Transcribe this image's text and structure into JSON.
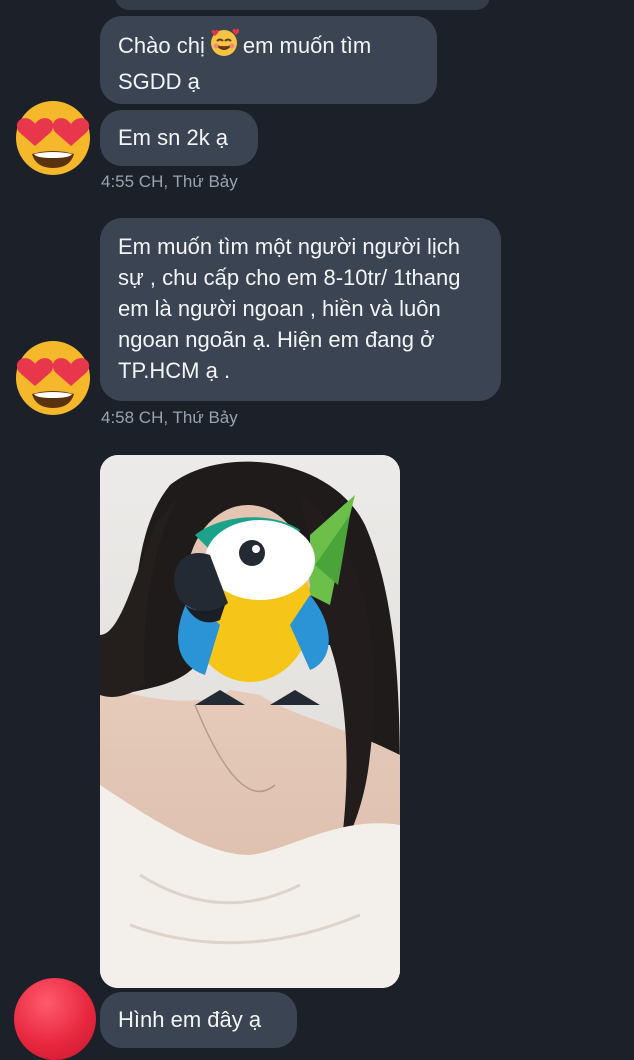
{
  "messages": [
    {
      "text_before": "Chào chị",
      "text_after": "em muốn tìm SGDD ạ",
      "inline_icon": "smiling-face-with-hearts-icon"
    },
    {
      "text": "Em sn 2k ạ"
    },
    {
      "timestamp": "4:55 CH, Thứ Bảy"
    },
    {
      "text": "Em muốn tìm một người người lịch sự , chu cấp cho em 8-10tr/ 1thang em là người ngoan , hiền và luôn ngoan ngoãn ạ. Hiện em đang ở TP.HCM ạ ."
    },
    {
      "timestamp": "4:58 CH, Thứ Bảy"
    },
    {
      "image": "photo-with-parrot-sticker"
    },
    {
      "text": "Hình em đây ạ"
    }
  ],
  "icons": {
    "avatar": "heart-eyes-emoji-icon",
    "last_avatar": "red-circle-avatar",
    "sticker": "parrot-sticker-icon"
  },
  "colors": {
    "background": "#1b2029",
    "bubble": "#3a4452",
    "timestamp": "#9aa3b0"
  }
}
